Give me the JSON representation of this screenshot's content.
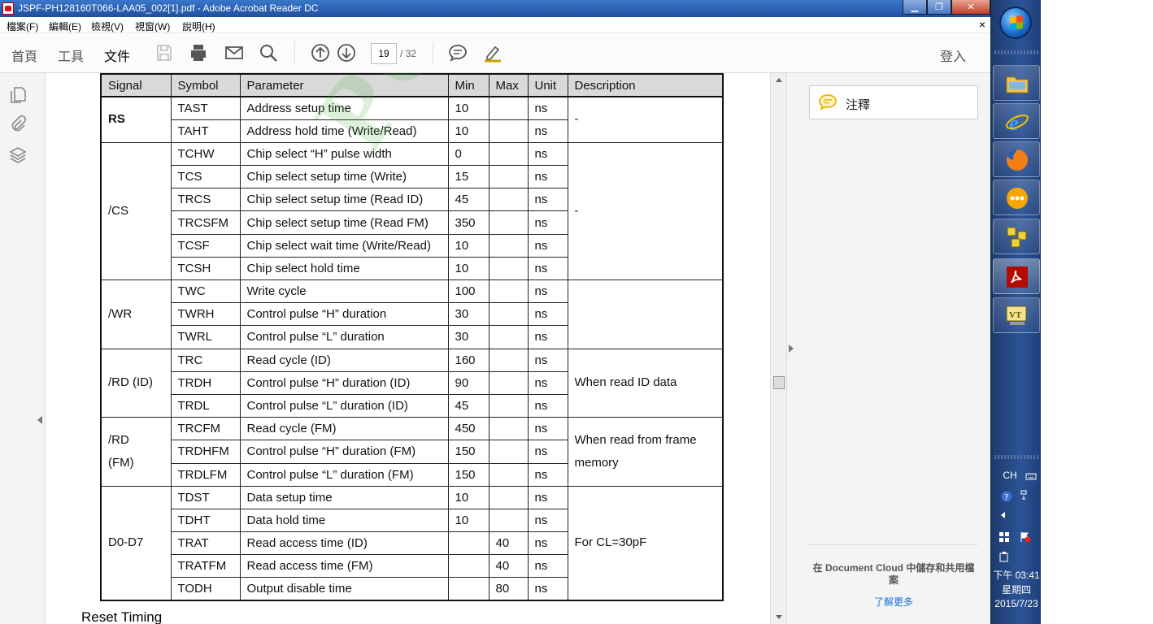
{
  "window": {
    "title": "JSPF-PH128160T066-LAA05_002[1].pdf - Adobe Acrobat Reader DC",
    "min_glyph": "▁",
    "max_glyph": "❐",
    "close_glyph": "✕"
  },
  "menu": {
    "items": [
      "檔案(F)",
      "編輯(E)",
      "檢視(V)",
      "視窗(W)",
      "說明(H)"
    ],
    "close_glyph": "×"
  },
  "toolbar": {
    "tabs": [
      "首頁",
      "工具",
      "文件"
    ],
    "active_tab": "文件",
    "current_page": "19",
    "total_pages": "/ 32",
    "sign_in": "登入"
  },
  "table": {
    "headers": [
      "Signal",
      "Symbol",
      "Parameter",
      "Min",
      "Max",
      "Unit",
      "Description"
    ],
    "groups": [
      {
        "signal": "RS",
        "description": "-",
        "rows": [
          {
            "symbol": "TAST",
            "parameter": "Address setup time",
            "min": "10",
            "max": "",
            "unit": "ns"
          },
          {
            "symbol": "TAHT",
            "parameter": "Address hold time (Write/Read)",
            "min": "10",
            "max": "",
            "unit": "ns"
          }
        ]
      },
      {
        "signal": "/CS",
        "description": "-",
        "rows": [
          {
            "symbol": "TCHW",
            "parameter": "Chip select “H” pulse width",
            "min": "0",
            "max": "",
            "unit": "ns"
          },
          {
            "symbol": "TCS",
            "parameter": "Chip select setup time (Write)",
            "min": "15",
            "max": "",
            "unit": "ns"
          },
          {
            "symbol": "TRCS",
            "parameter": "Chip select setup time (Read ID)",
            "min": "45",
            "max": "",
            "unit": "ns"
          },
          {
            "symbol": "TRCSFM",
            "parameter": "Chip select setup time (Read FM)",
            "min": "350",
            "max": "",
            "unit": "ns"
          },
          {
            "symbol": "TCSF",
            "parameter": "Chip select wait time (Write/Read)",
            "min": "10",
            "max": "",
            "unit": "ns"
          },
          {
            "symbol": "TCSH",
            "parameter": "Chip select hold time",
            "min": "10",
            "max": "",
            "unit": "ns"
          }
        ]
      },
      {
        "signal": "/WR",
        "description": "",
        "rows": [
          {
            "symbol": "TWC",
            "parameter": "Write cycle",
            "min": "100",
            "max": "",
            "unit": "ns"
          },
          {
            "symbol": "TWRH",
            "parameter": "Control pulse “H” duration",
            "min": "30",
            "max": "",
            "unit": "ns"
          },
          {
            "symbol": "TWRL",
            "parameter": "Control pulse “L” duration",
            "min": "30",
            "max": "",
            "unit": "ns"
          }
        ]
      },
      {
        "signal": "/RD (ID)",
        "description": "When read ID data",
        "rows": [
          {
            "symbol": "TRC",
            "parameter": "Read cycle (ID)",
            "min": "160",
            "max": "",
            "unit": "ns"
          },
          {
            "symbol": "TRDH",
            "parameter": "Control pulse “H” duration (ID)",
            "min": "90",
            "max": "",
            "unit": "ns"
          },
          {
            "symbol": "TRDL",
            "parameter": "Control pulse “L” duration (ID)",
            "min": "45",
            "max": "",
            "unit": "ns"
          }
        ]
      },
      {
        "signal": "/RD\n(FM)",
        "description": "When read from frame\nmemory",
        "rows": [
          {
            "symbol": "TRCFM",
            "parameter": "Read cycle (FM)",
            "min": "450",
            "max": "",
            "unit": "ns"
          },
          {
            "symbol": "TRDHFM",
            "parameter": "Control pulse “H” duration (FM)",
            "min": "150",
            "max": "",
            "unit": "ns"
          },
          {
            "symbol": "TRDLFM",
            "parameter": "Control pulse “L” duration (FM)",
            "min": "150",
            "max": "",
            "unit": "ns"
          }
        ]
      },
      {
        "signal": "D0-D7",
        "description": "For CL=30pF",
        "rows": [
          {
            "symbol": "TDST",
            "parameter": "Data setup time",
            "min": "10",
            "max": "",
            "unit": "ns"
          },
          {
            "symbol": "TDHT",
            "parameter": "Data hold time",
            "min": "10",
            "max": "",
            "unit": "ns"
          },
          {
            "symbol": "TRAT",
            "parameter": "Read access time (ID)",
            "min": "",
            "max": "40",
            "unit": "ns"
          },
          {
            "symbol": "TRATFM",
            "parameter": "Read access time (FM)",
            "min": "",
            "max": "40",
            "unit": "ns"
          },
          {
            "symbol": "TODH",
            "parameter": "Output disable time",
            "min": "",
            "max": "80",
            "unit": "ns"
          }
        ]
      }
    ]
  },
  "doc": {
    "section_heading": "Reset Timing",
    "watermark": "POWERTIP"
  },
  "right_pane": {
    "comment_label": "注釋",
    "cloud_text": "在 Document Cloud 中儲存和共用檔案",
    "learn_more": "了解更多"
  },
  "taskbar": {
    "apps": [
      "windows-explorer",
      "internet-explorer",
      "firefox",
      "app-orange",
      "app-yellow-grid",
      "adobe-acrobat",
      "app-vt"
    ],
    "language": "CH",
    "time": "下午 03:41",
    "weekday": "星期四",
    "date": "2015/7/23"
  },
  "colors": {
    "accent": "#1a73e8",
    "titlebar": "#2a5fb0",
    "taskbar": "#2b5496",
    "watermark": "#3caa3c"
  }
}
